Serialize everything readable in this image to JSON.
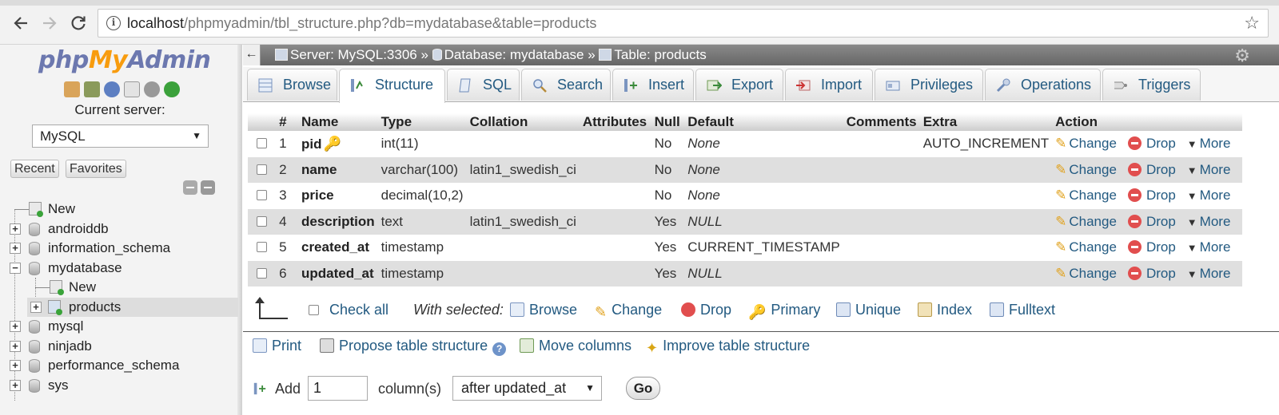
{
  "browser": {
    "url_host": "localhost",
    "url_path": "/phpmyadmin/tbl_structure.php?db=mydatabase&table=products"
  },
  "sidebar": {
    "logo": {
      "php": "php",
      "my": "My",
      "admin": "Admin"
    },
    "current_server_label": "Current server:",
    "server_value": "MySQL",
    "recent_label": "Recent",
    "favorites_label": "Favorites",
    "tree": {
      "new": "New",
      "androiddb": "androiddb",
      "information_schema": "information_schema",
      "mydatabase": "mydatabase",
      "mydb_new": "New",
      "products": "products",
      "mysql": "mysql",
      "ninjadb": "ninjadb",
      "performance_schema": "performance_schema",
      "sys": "sys"
    }
  },
  "breadcrumb": {
    "server": "Server: MySQL:3306",
    "sep1": " » ",
    "database": "Database: mydatabase",
    "sep2": " » ",
    "table": "Table: products"
  },
  "tabs": {
    "browse": "Browse",
    "structure": "Structure",
    "sql": "SQL",
    "search": "Search",
    "insert": "Insert",
    "export": "Export",
    "import": "Import",
    "privileges": "Privileges",
    "operations": "Operations",
    "triggers": "Triggers"
  },
  "table": {
    "headers": [
      "#",
      "Name",
      "Type",
      "Collation",
      "Attributes",
      "Null",
      "Default",
      "Comments",
      "Extra",
      "Action"
    ],
    "rows": [
      {
        "num": "1",
        "name": "pid",
        "type": "int(11)",
        "collation": "",
        "attributes": "",
        "null": "No",
        "default": "None",
        "comments": "",
        "extra": "AUTO_INCREMENT"
      },
      {
        "num": "2",
        "name": "name",
        "type": "varchar(100)",
        "collation": "latin1_swedish_ci",
        "attributes": "",
        "null": "No",
        "default": "None",
        "comments": "",
        "extra": ""
      },
      {
        "num": "3",
        "name": "price",
        "type": "decimal(10,2)",
        "collation": "",
        "attributes": "",
        "null": "No",
        "default": "None",
        "comments": "",
        "extra": ""
      },
      {
        "num": "4",
        "name": "description",
        "type": "text",
        "collation": "latin1_swedish_ci",
        "attributes": "",
        "null": "Yes",
        "default": "NULL",
        "comments": "",
        "extra": ""
      },
      {
        "num": "5",
        "name": "created_at",
        "type": "timestamp",
        "collation": "",
        "attributes": "",
        "null": "Yes",
        "default": "CURRENT_TIMESTAMP",
        "comments": "",
        "extra": ""
      },
      {
        "num": "6",
        "name": "updated_at",
        "type": "timestamp",
        "collation": "",
        "attributes": "",
        "null": "Yes",
        "default": "NULL",
        "comments": "",
        "extra": ""
      }
    ],
    "actions": {
      "change": "Change",
      "drop": "Drop",
      "more": "More"
    }
  },
  "with_selected": {
    "check_all": "Check all",
    "label": "With selected:",
    "browse": "Browse",
    "change": "Change",
    "drop": "Drop",
    "primary": "Primary",
    "unique": "Unique",
    "index": "Index",
    "fulltext": "Fulltext"
  },
  "bottom_links": {
    "print": "Print",
    "propose": "Propose table structure",
    "move": "Move columns",
    "improve": "Improve table structure"
  },
  "add_column": {
    "add_label": "Add",
    "count": "1",
    "columns_label": "column(s)",
    "position": "after updated_at",
    "go": "Go"
  }
}
